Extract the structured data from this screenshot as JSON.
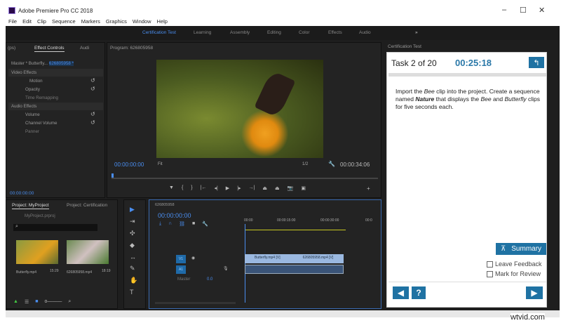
{
  "window": {
    "title": "Adobe Premiere Pro CC 2018",
    "minimize": "–",
    "maximize": "☐",
    "close": "✕"
  },
  "menu": [
    "File",
    "Edit",
    "Clip",
    "Sequence",
    "Markers",
    "Graphics",
    "Window",
    "Help"
  ],
  "workspaces": [
    "Certification Test",
    "Learning",
    "Assembly",
    "Editing",
    "Color",
    "Effects",
    "Audio"
  ],
  "workspace_more": "»",
  "effect_controls": {
    "tabs": [
      "(ps)",
      "Effect Controls",
      "Audi"
    ],
    "master": "Master * Butterfly...",
    "sequence": "626805958 *",
    "video_effects": "Video Effects",
    "audio_effects": "Audio Effects",
    "items": [
      "Motion",
      "Opacity",
      "Time Remapping",
      "Volume",
      "Channel Volume",
      "Panner"
    ],
    "timecode": "00:00:00:00"
  },
  "program": {
    "title": "Program: 626805958",
    "timecode": "00:00:00:00",
    "fit": "Fit",
    "quality": "1/2",
    "duration": "00:00:34:06"
  },
  "project": {
    "tabs": [
      "Project: MyProject",
      "Project: Certification"
    ],
    "file": "MyProject.prproj",
    "clips": [
      {
        "name": "Butterfly.mp4",
        "dur": "15:29"
      },
      {
        "name": "626805958.mp4",
        "dur": "18:19"
      }
    ]
  },
  "timeline": {
    "title": "626805958",
    "timecode": "00:00:00:00",
    "ruler": [
      "00:00",
      "00:00:15:00",
      "00:00:30:00",
      "00:0"
    ],
    "tracks": {
      "v1": "V1",
      "a1": "A1",
      "master": "Master",
      "master_val": "0.0"
    },
    "clips": [
      "Butterfly.mp4 [V]",
      "626805958.mp4 [V]"
    ]
  },
  "cert": {
    "panel_title": "Certification Test",
    "task": "Task 2 of 20",
    "timer": "00:25:18",
    "instruction_parts": [
      "Import the ",
      "Bee",
      " clip into the project. Create a sequence named ",
      "Nature",
      " that displays the ",
      "Bee",
      " and ",
      "Butterfly",
      " clips for five seconds each."
    ],
    "summary": "Summary",
    "leave_feedback": "Leave Feedback",
    "mark_review": "Mark for Review"
  },
  "watermark": "wtvid.com"
}
